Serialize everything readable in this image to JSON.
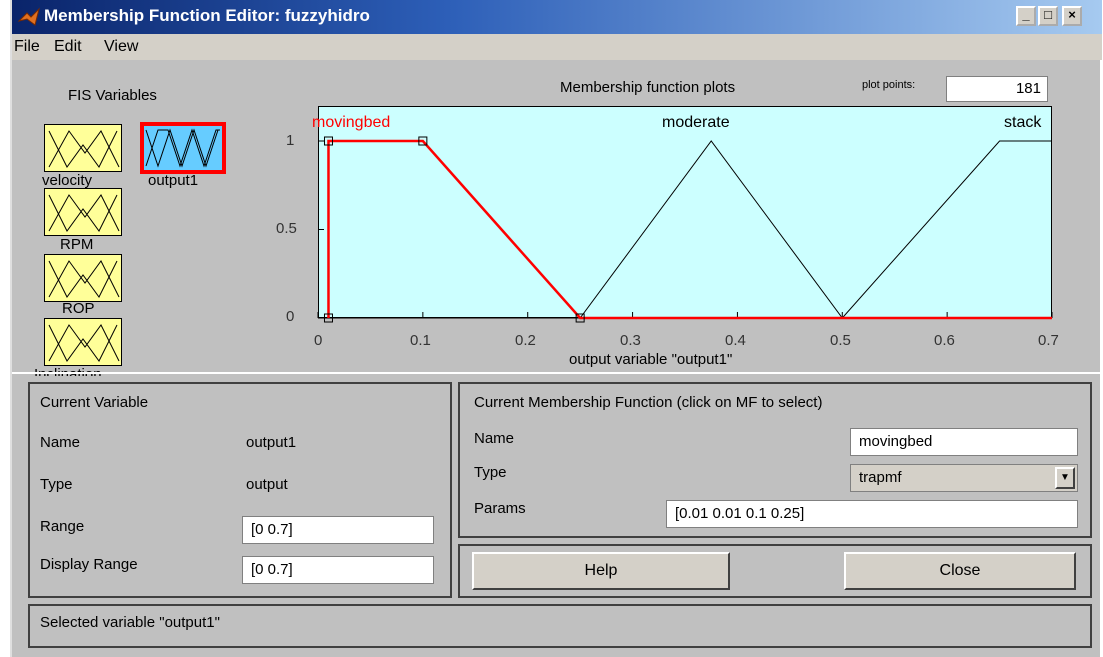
{
  "window": {
    "title": "Membership Function Editor: fuzzyhidro",
    "min_label": "_",
    "max_label": "□",
    "close_label": "×"
  },
  "menu": {
    "file": "File",
    "edit": "Edit",
    "view": "View"
  },
  "fis": {
    "title": "FIS Variables",
    "inputs": [
      {
        "label": "velocity"
      },
      {
        "label": "RPM"
      },
      {
        "label": "ROP"
      },
      {
        "label": "Inclination"
      }
    ],
    "output": {
      "label": "output1"
    }
  },
  "plot": {
    "title": "Membership function plots",
    "plot_points_label": "plot points:",
    "plot_points_value": "181",
    "xlabel": "output variable \"output1\"",
    "xticks": [
      "0",
      "0.1",
      "0.2",
      "0.3",
      "0.4",
      "0.5",
      "0.6",
      "0.7"
    ],
    "yticks": [
      "1",
      "0.5",
      "0"
    ],
    "mf_names": [
      "movingbed",
      "moderate",
      "stack"
    ],
    "selected_color": "#ff0000",
    "unselected_color": "#000000",
    "background": "#ccffff"
  },
  "chart_data": {
    "type": "line",
    "title": "Membership function plots",
    "xlabel": "output variable \"output1\"",
    "ylabel": "",
    "xlim": [
      0,
      0.7
    ],
    "ylim": [
      0,
      1
    ],
    "grid": false,
    "series": [
      {
        "name": "movingbed",
        "mf_type": "trapmf",
        "x": [
          0.01,
          0.01,
          0.1,
          0.25,
          0.7
        ],
        "y": [
          0,
          1,
          1,
          0,
          0
        ]
      },
      {
        "name": "moderate",
        "mf_type": "trimf",
        "x": [
          0,
          0.25,
          0.375,
          0.5,
          0.7
        ],
        "y": [
          0,
          0,
          1,
          0,
          0
        ]
      },
      {
        "name": "stack",
        "mf_type": "trapmf",
        "x": [
          0,
          0.5,
          0.65,
          0.7
        ],
        "y": [
          0,
          0,
          1,
          1
        ]
      }
    ]
  },
  "current_variable": {
    "title": "Current Variable",
    "name_label": "Name",
    "name_value": "output1",
    "type_label": "Type",
    "type_value": "output",
    "range_label": "Range",
    "range_value": "[0 0.7]",
    "display_range_label": "Display Range",
    "display_range_value": "[0 0.7]"
  },
  "current_mf": {
    "title": "Current Membership Function (click on MF to select)",
    "name_label": "Name",
    "name_value": "movingbed",
    "type_label": "Type",
    "type_value": "trapmf",
    "params_label": "Params",
    "params_value": "[0.01 0.01 0.1 0.25]"
  },
  "buttons": {
    "help": "Help",
    "close": "Close"
  },
  "status": {
    "text": "Selected variable \"output1\""
  }
}
